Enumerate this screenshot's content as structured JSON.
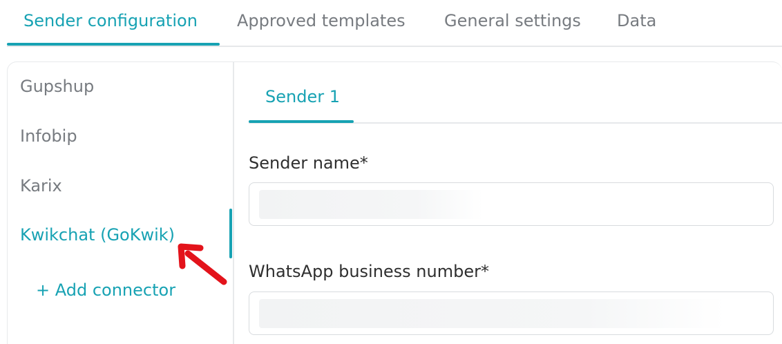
{
  "top_tabs": [
    {
      "label": "Sender configuration",
      "active": true
    },
    {
      "label": "Approved templates",
      "active": false
    },
    {
      "label": "General settings",
      "active": false
    },
    {
      "label": "Data",
      "active": false
    }
  ],
  "connectors": {
    "items": [
      {
        "label": "Gupshup",
        "active": false
      },
      {
        "label": "Infobip",
        "active": false
      },
      {
        "label": "Karix",
        "active": false
      },
      {
        "label": "Kwikchat (GoKwik)",
        "active": true
      }
    ],
    "add_label": "+ Add connector"
  },
  "sender_tabs": [
    {
      "label": "Sender 1",
      "active": true
    }
  ],
  "form": {
    "sender_name_label": "Sender name*",
    "business_number_label": "WhatsApp business number*"
  },
  "annotation": {
    "icon": "red-arrow-icon",
    "color": "#e3131b"
  },
  "colors": {
    "accent": "#17a2b3",
    "muted_text": "#777b80",
    "text": "#2f2f2f",
    "border": "#e7e9eb"
  }
}
